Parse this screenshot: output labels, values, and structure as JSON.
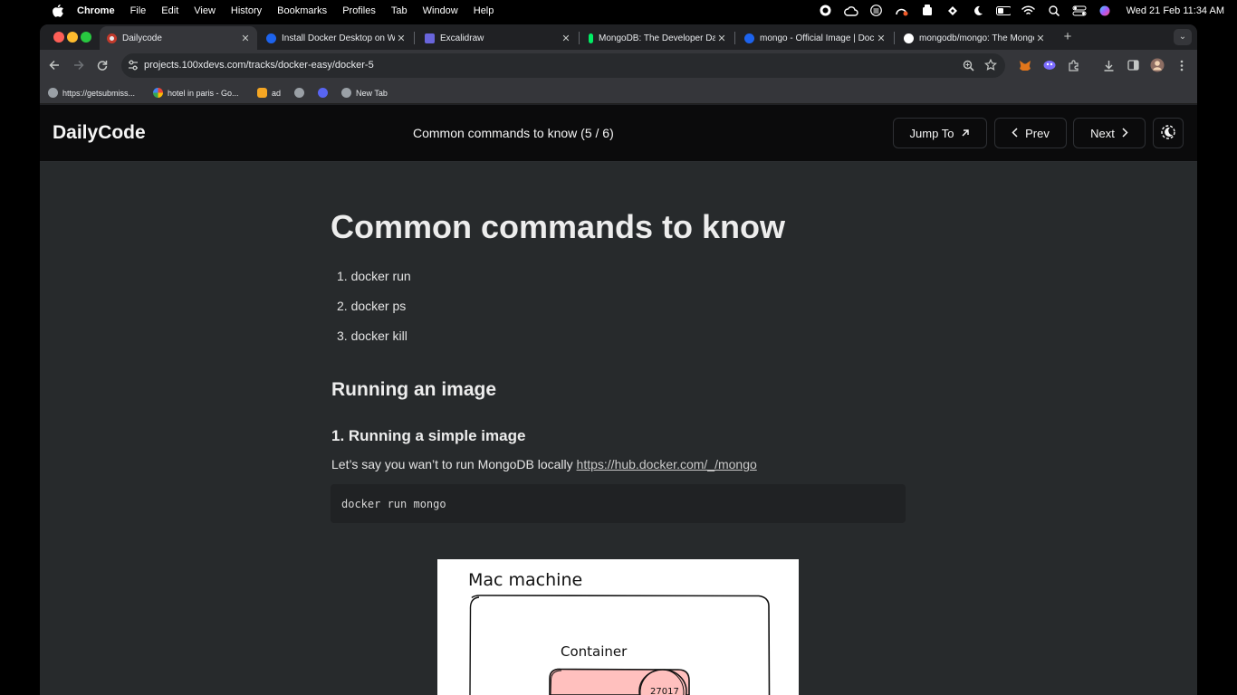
{
  "menubar": {
    "app": "Chrome",
    "items": [
      "File",
      "Edit",
      "View",
      "History",
      "Bookmarks",
      "Profiles",
      "Tab",
      "Window",
      "Help"
    ],
    "clock": "Wed 21 Feb  11:34 AM"
  },
  "tabs": [
    {
      "title": "Dailycode",
      "active": true,
      "favicon_color": "#e8eaed"
    },
    {
      "title": "Install Docker Desktop on Wi",
      "active": false,
      "favicon_color": "#1d63ed"
    },
    {
      "title": "Excalidraw",
      "active": false,
      "favicon_color": "#6965db"
    },
    {
      "title": "MongoDB: The Developer Da",
      "active": false,
      "favicon_color": "#00ed64"
    },
    {
      "title": "mongo - Official Image | Dock",
      "active": false,
      "favicon_color": "#1d63ed"
    },
    {
      "title": "mongodb/mongo: The Mongo",
      "active": false,
      "favicon_color": "#ffffff"
    }
  ],
  "address": {
    "url": "projects.100xdevs.com/tracks/docker-easy/docker-5"
  },
  "bookmarks": [
    {
      "label": "https://getsubmiss...",
      "favicon_color": "#9aa0a6"
    },
    {
      "label": "hotel in paris - Go...",
      "favicon_color": "#4285f4"
    },
    {
      "label": "ad",
      "favicon_color": "#f5a623"
    },
    {
      "label": "",
      "favicon_color": "#9aa0a6"
    },
    {
      "label": "",
      "favicon_color": "#5865f2"
    },
    {
      "label": "New Tab",
      "favicon_color": "#9aa0a6"
    }
  ],
  "app": {
    "brand": "DailyCode",
    "lesson_title": "Common commands to know (5 / 6)",
    "jump_label": "Jump To",
    "prev_label": "Prev",
    "next_label": "Next"
  },
  "article": {
    "h1": "Common commands to know",
    "commands": [
      "docker run",
      "docker ps",
      "docker kill"
    ],
    "h2": "Running an image",
    "h3": "1. Running a simple image",
    "para_text": "Let’s say you wan’t to run MongoDB locally ",
    "para_link": "https://hub.docker.com/_/mongo",
    "code": "docker run mongo"
  },
  "diagram": {
    "title": "Mac machine",
    "container_label": "Container",
    "port": "27017"
  }
}
